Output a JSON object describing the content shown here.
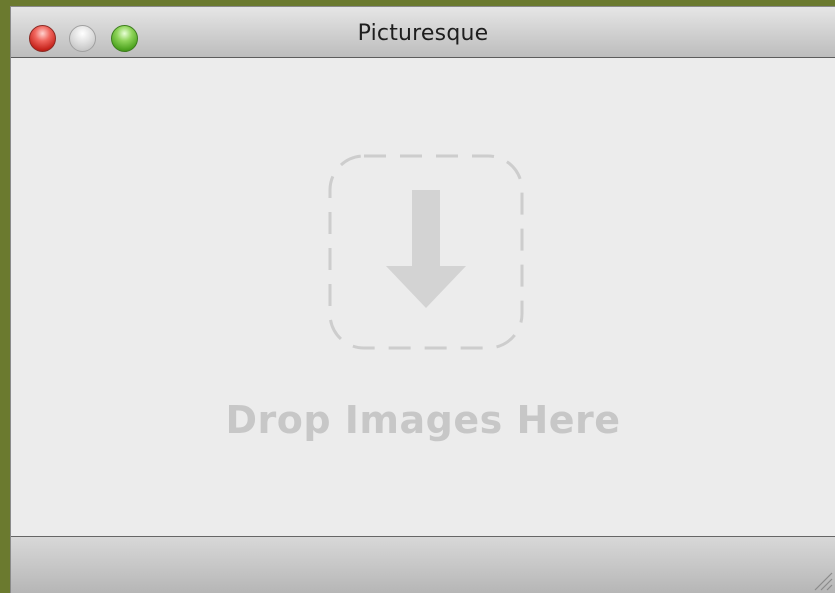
{
  "window": {
    "title": "Picturesque",
    "buttons": {
      "close": "close-button",
      "minimize": "minimize-button",
      "zoom": "zoom-button"
    }
  },
  "drop_area": {
    "label": "Drop Images Here",
    "icon": "download-arrow-icon"
  },
  "colors": {
    "desktop": "#6b7a2f",
    "window_bg": "#ececec",
    "drop_placeholder": "#c7c7c7",
    "close": "#e0433a",
    "zoom": "#6abf34"
  }
}
